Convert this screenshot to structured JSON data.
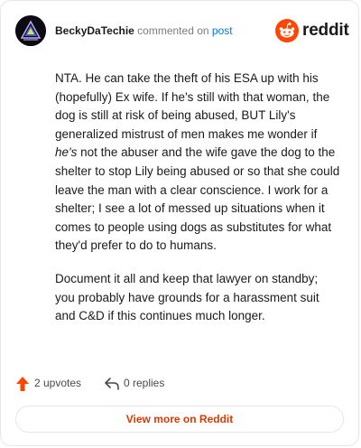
{
  "header": {
    "author": "BeckyDaTechie",
    "commented_text": "commented on",
    "post_link": "post",
    "brand_name": "reddit",
    "brand_color": "#ff4500"
  },
  "comment": {
    "p1_a": "NTA. He can take the theft of his ESA up with his (hopefully) Ex wife. If he's still with that woman, the dog is still at risk of being abused, BUT Lily's generalized mistrust of men makes me wonder if ",
    "p1_em": "he's",
    "p1_b": " not the abuser and the wife gave the dog to the shelter to stop Lily being abused or so that she could leave the man with a clear conscience. I work for a shelter; I see a lot of messed up situations when it comes to people using dogs as substitutes for what they'd prefer to do to humans.",
    "p2": "Document it all and keep that lawyer on standby; you probably have grounds for a harassment suit and C&D if this continues much longer."
  },
  "actions": {
    "upvotes": "2 upvotes",
    "replies": "0 replies",
    "upvote_icon": "upvote-arrow-icon",
    "reply_icon": "reply-arrow-icon",
    "upvote_color": "#ff4500"
  },
  "footer": {
    "view_more": "View more on Reddit"
  }
}
